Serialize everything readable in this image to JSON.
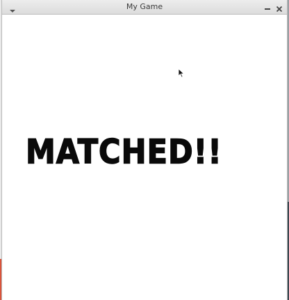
{
  "window": {
    "title": "My Game"
  },
  "game": {
    "message": "MATCHED!!"
  },
  "icons": {
    "menu": "chevron-down-icon",
    "minimize": "minimize-icon",
    "close": "close-icon",
    "cursor": "mouse-pointer-icon"
  },
  "colors": {
    "message": "#0a0a0a",
    "canvas": "#ffffff",
    "titlebar": "#e4e4e4"
  }
}
